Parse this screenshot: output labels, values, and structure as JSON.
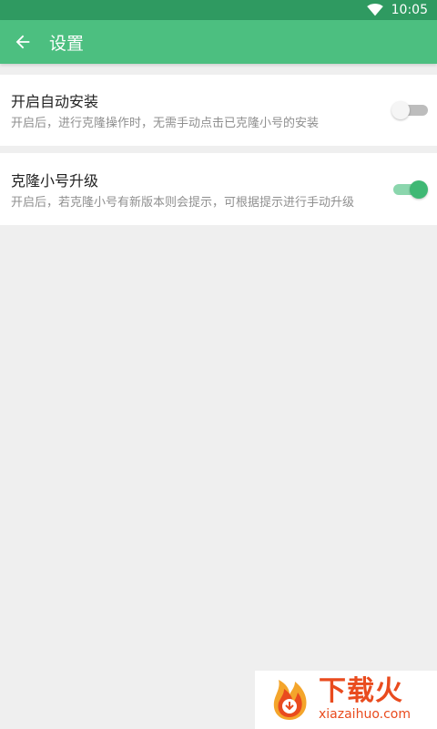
{
  "status_bar": {
    "time": "10:05",
    "wifi_icon": "wifi-icon"
  },
  "toolbar": {
    "back_icon": "arrow-left-icon",
    "title": "设置"
  },
  "settings": [
    {
      "title": "开启自动安装",
      "description": "开启后，进行克隆操作时，无需手动点击已克隆小号的安装",
      "enabled": false
    },
    {
      "title": "克隆小号升级",
      "description": "开启后，若克隆小号有新版本则会提示，可根据提示进行手动升级",
      "enabled": true
    }
  ],
  "colors": {
    "status_bar": "#2f9a61",
    "toolbar": "#4cbf80",
    "switch_on": "#3fb874",
    "switch_track_on": "#8bd6ad",
    "switch_track_off": "#bdbdbd",
    "watermark_text": "#e94b1e"
  },
  "watermark": {
    "brand": "下载火",
    "domain": "xiazaihuo.com"
  }
}
